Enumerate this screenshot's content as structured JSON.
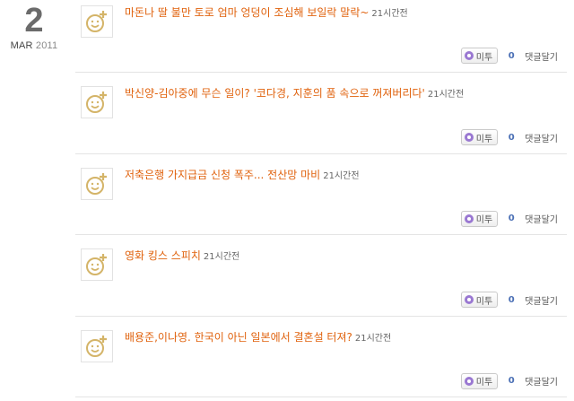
{
  "date": {
    "day": "2",
    "month": "MAR",
    "year": "2011"
  },
  "icons": {
    "avatar": "smiley-plus-icon",
    "me2": "me2day-bubble-icon"
  },
  "colors": {
    "link": "#e0620d",
    "count": "#4a6fb5",
    "me2_dot": "#9a78d2",
    "avatar": "#d4b468"
  },
  "posts": [
    {
      "title": "마돈나 딸 불만 토로 엄마 엉덩이 조심해 보일락 말락~",
      "time": "21시간전",
      "me2_label": "미투",
      "count": "0",
      "reply_label": "댓글달기"
    },
    {
      "title": "박신양-김아중에 무슨 일이? '코다경, 지훈의 품 속으로 꺼져버리다'",
      "time": "21시간전",
      "me2_label": "미투",
      "count": "0",
      "reply_label": "댓글달기"
    },
    {
      "title": "저축은행 가지급금 신청 폭주... 전산망 마비",
      "time": "21시간전",
      "me2_label": "미투",
      "count": "0",
      "reply_label": "댓글달기"
    },
    {
      "title": "영화 킹스 스피치",
      "time": "21시간전",
      "me2_label": "미투",
      "count": "0",
      "reply_label": "댓글달기"
    },
    {
      "title": "배용준,이나영. 한국이 아닌 일본에서 결혼설 터져?",
      "time": "21시간전",
      "me2_label": "미투",
      "count": "0",
      "reply_label": "댓글달기"
    }
  ]
}
